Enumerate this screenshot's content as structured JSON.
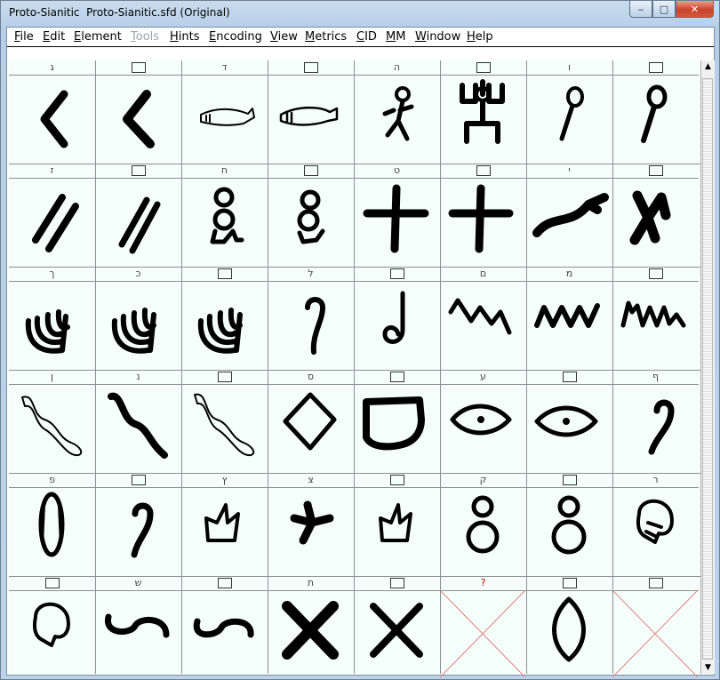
{
  "window": {
    "title": "Proto-Sianitic  Proto-Sianitic.sfd (Original)"
  },
  "controls": {
    "minimize": "‒",
    "maximize": "□",
    "close": "✕"
  },
  "menu": [
    {
      "label": "File",
      "disabled": false
    },
    {
      "label": "Edit",
      "disabled": false
    },
    {
      "label": "Element",
      "disabled": false
    },
    {
      "label": "Tools",
      "disabled": true
    },
    {
      "label": "Hints",
      "disabled": false
    },
    {
      "label": "Encoding",
      "disabled": false
    },
    {
      "label": "View",
      "disabled": false
    },
    {
      "label": "Metrics",
      "disabled": false
    },
    {
      "label": "CID",
      "disabled": false
    },
    {
      "label": "MM",
      "disabled": false
    },
    {
      "label": "Window",
      "disabled": false
    },
    {
      "label": "Help",
      "disabled": false
    }
  ],
  "glyph_cells": [
    {
      "label": "ג",
      "glyph": "gimel"
    },
    {
      "label": "",
      "glyph": "gimel2"
    },
    {
      "label": "ד",
      "glyph": "fish-outline"
    },
    {
      "label": "",
      "glyph": "fish-outline2"
    },
    {
      "label": "ה",
      "glyph": "man"
    },
    {
      "label": "",
      "glyph": "man-arms-up"
    },
    {
      "label": "ו",
      "glyph": "mace"
    },
    {
      "label": "",
      "glyph": "mace2"
    },
    {
      "label": "ז",
      "glyph": "double-slash"
    },
    {
      "label": "",
      "glyph": "double-slash2"
    },
    {
      "label": "ח",
      "glyph": "loops"
    },
    {
      "label": "",
      "glyph": "loops2"
    },
    {
      "label": "ט",
      "glyph": "cross"
    },
    {
      "label": "",
      "glyph": "cross2"
    },
    {
      "label": "י",
      "glyph": "arm"
    },
    {
      "label": "",
      "glyph": "hand"
    },
    {
      "label": "ך",
      "glyph": "palm"
    },
    {
      "label": "כ",
      "glyph": "palm2"
    },
    {
      "label": "",
      "glyph": "palm3"
    },
    {
      "label": "ל",
      "glyph": "goad"
    },
    {
      "label": "",
      "glyph": "goad2"
    },
    {
      "label": "ם",
      "glyph": "water"
    },
    {
      "label": "מ",
      "glyph": "water2"
    },
    {
      "label": "",
      "glyph": "water3"
    },
    {
      "label": "ן",
      "glyph": "snake-outline"
    },
    {
      "label": "נ",
      "glyph": "snake"
    },
    {
      "label": "",
      "glyph": "snake-outline2"
    },
    {
      "label": "ס",
      "glyph": "diamond"
    },
    {
      "label": "",
      "glyph": "shield"
    },
    {
      "label": "ע",
      "glyph": "eye"
    },
    {
      "label": "",
      "glyph": "eye2"
    },
    {
      "label": "ף",
      "glyph": "mouth"
    },
    {
      "label": "פ",
      "glyph": "oval"
    },
    {
      "label": "",
      "glyph": "mouth2"
    },
    {
      "label": "ץ",
      "glyph": "plant"
    },
    {
      "label": "צ",
      "glyph": "plant-bold"
    },
    {
      "label": "",
      "glyph": "plant2"
    },
    {
      "label": "ק",
      "glyph": "eight"
    },
    {
      "label": "",
      "glyph": "eight2"
    },
    {
      "label": "ר",
      "glyph": "head"
    },
    {
      "label": "",
      "glyph": "head2"
    },
    {
      "label": "ש",
      "glyph": "bow"
    },
    {
      "label": "",
      "glyph": "bow2"
    },
    {
      "label": "ת",
      "glyph": "x-bold"
    },
    {
      "label": "",
      "glyph": "x"
    },
    {
      "label": "?",
      "glyph": "empty",
      "missing": true
    },
    {
      "label": "",
      "glyph": "leaf"
    },
    {
      "label": "",
      "glyph": "empty"
    }
  ]
}
